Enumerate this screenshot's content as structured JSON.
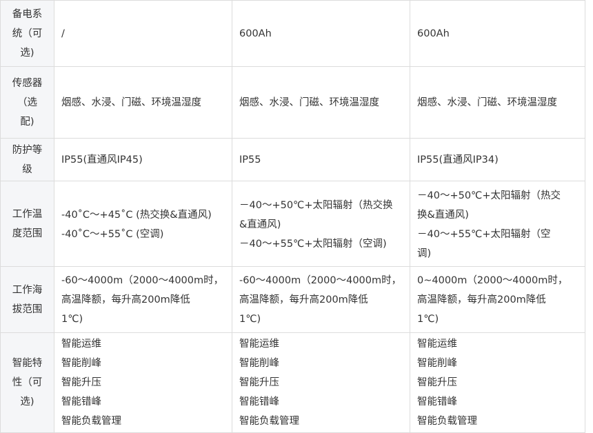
{
  "table": {
    "rows": [
      {
        "label": [
          "备电系",
          "统（可",
          "选)"
        ],
        "cells": [
          [
            "/"
          ],
          [
            "600Ah"
          ],
          [
            "600Ah"
          ]
        ]
      },
      {
        "label": [
          "传感器",
          "（选",
          "配)"
        ],
        "cells": [
          [
            "烟感、水浸、门磁、环境温湿度"
          ],
          [
            "烟感、水浸、门磁、环境温湿度"
          ],
          [
            "烟感、水浸、门磁、环境温湿度"
          ]
        ]
      },
      {
        "label": [
          "防护等",
          "级"
        ],
        "cells": [
          [
            "IP55(直通风IP45)"
          ],
          [
            "IP55"
          ],
          [
            "IP55(直通风IP34)"
          ]
        ]
      },
      {
        "label": [
          "工作温",
          "度范围"
        ],
        "cells": [
          [
            "-40˚C～+45˚C (热交换&直通风)",
            "-40˚C～+55˚C (空调)"
          ],
          [
            "－40～+50℃+太阳辐射（热交换",
            "&直通风)",
            "－40～+55℃+太阳辐射（空调)"
          ],
          [
            "－40～+50℃+太阳辐射（热交",
            "换&直通风)",
            "－40～+55℃+太阳辐射（空",
            "调)"
          ]
        ]
      },
      {
        "label": [
          "工作海",
          "拔范围"
        ],
        "cells": [
          [
            "-60～4000m（2000～4000m时，",
            "高温降额，每升高200m降低",
            "1℃)"
          ],
          [
            "-60～4000m（2000～4000m时，",
            "高温降额，每升高200m降低",
            "1℃)"
          ],
          [
            "0~4000m（2000～4000m时，",
            "高温降额，每升高200m降低",
            "1℃)"
          ]
        ]
      },
      {
        "label": [
          "智能特",
          "性（可",
          "选)"
        ],
        "cells": [
          [
            "智能运维",
            "智能削峰",
            "智能升压",
            "智能错峰",
            "智能负载管理"
          ],
          [
            "智能运维",
            "智能削峰",
            "智能升压",
            "智能错峰",
            "智能负载管理"
          ],
          [
            "智能运维",
            "智能削峰",
            "智能升压",
            "智能错峰",
            "智能负载管理"
          ]
        ]
      }
    ]
  }
}
